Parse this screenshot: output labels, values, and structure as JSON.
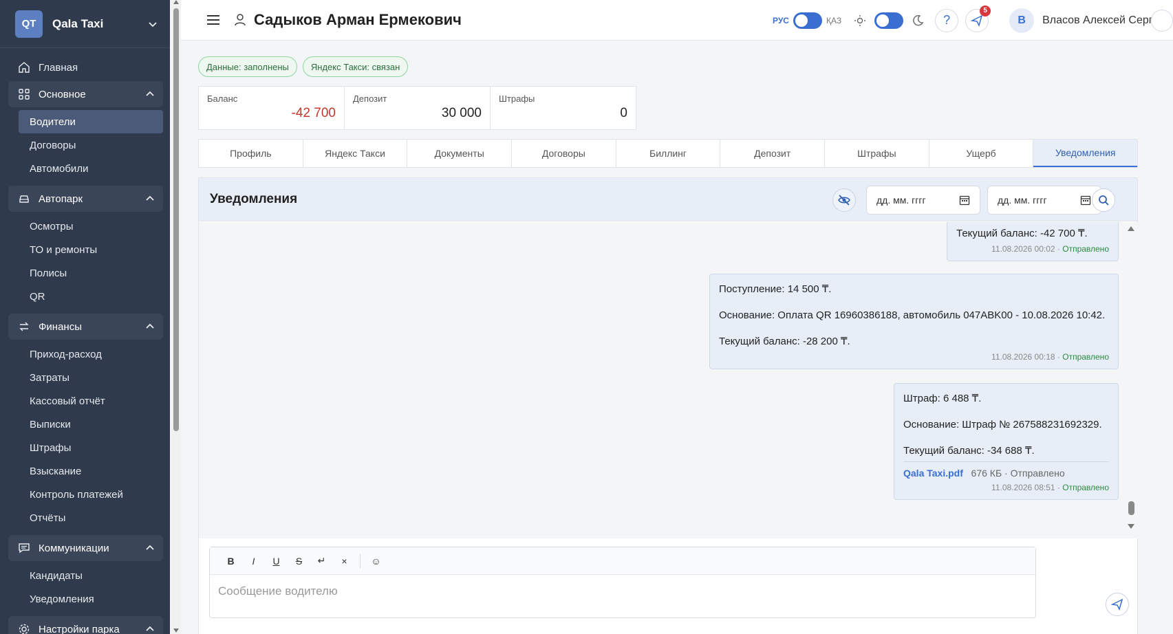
{
  "brand": {
    "badge": "QT",
    "name": "Qala Taxi"
  },
  "sidebar": {
    "home": "Главная",
    "groups": [
      {
        "label": "Основное",
        "items": [
          "Водители",
          "Договоры",
          "Автомобили"
        ]
      },
      {
        "label": "Автопарк",
        "items": [
          "Осмотры",
          "ТО и ремонты",
          "Полисы",
          "QR"
        ]
      },
      {
        "label": "Финансы",
        "items": [
          "Приход-расход",
          "Затраты",
          "Кассовый отчёт",
          "Выписки",
          "Штрафы",
          "Взыскание",
          "Контроль платежей",
          "Отчёты"
        ]
      },
      {
        "label": "Коммуникации",
        "items": [
          "Кандидаты",
          "Уведомления"
        ]
      },
      {
        "label": "Настройки парка",
        "items": []
      }
    ]
  },
  "header": {
    "driver_name": "Садыков Арман Ермекович",
    "lang_ru": "РУС",
    "lang_kz": "ҚАЗ",
    "help": "?",
    "notif_count": "5",
    "avatar": "В",
    "user_name": "Власов Алексей Сергеев"
  },
  "badges": [
    "Данные: заполнены",
    "Яндекс Такси: связан"
  ],
  "stats": [
    {
      "label": "Баланс",
      "value": "-42 700"
    },
    {
      "label": "Депозит",
      "value": "30 000"
    },
    {
      "label": "Штрафы",
      "value": "0"
    }
  ],
  "tabs": [
    "Профиль",
    "Яндекс Такси",
    "Документы",
    "Договоры",
    "Биллинг",
    "Депозит",
    "Штрафы",
    "Ущерб",
    "Уведомления"
  ],
  "panel": {
    "title": "Уведомления",
    "date_from_placeholder": "дд. мм. гггг",
    "date_to_placeholder": "дд. мм. гггг"
  },
  "messages": [
    {
      "lines": [
        "Текущий баланс: -42 700 ₸."
      ],
      "time": "11.08.2026 00:02",
      "status": "Отправлено"
    },
    {
      "lines": [
        "Поступление: 14 500 ₸.",
        "Основание: Оплата QR 16960386188, автомобиль 047ABK00 - 10.08.2026 10:42.",
        "Текущий баланс: -28 200 ₸."
      ],
      "time": "11.08.2026 00:18",
      "status": "Отправлено"
    },
    {
      "lines": [
        "Штраф: 6 488 ₸.",
        "Основание: Штраф № 267588231692329.",
        "Текущий баланс: -34 688 ₸."
      ],
      "attachment": {
        "name": "Qala Taxi.pdf",
        "size": "676 КБ",
        "status": "Отправлено"
      },
      "time": "11.08.2026 08:51",
      "status": "Отправлено"
    }
  ],
  "composer": {
    "toolbar": [
      "B",
      "I",
      "U",
      "S",
      "↵",
      "×",
      "☺"
    ],
    "placeholder": "Сообщение водителю"
  },
  "colors": {
    "sidebar_bg": "#2f3a4d",
    "accent": "#3a6fd1",
    "negative": "#c0392b",
    "success": "#2b8a3e"
  }
}
